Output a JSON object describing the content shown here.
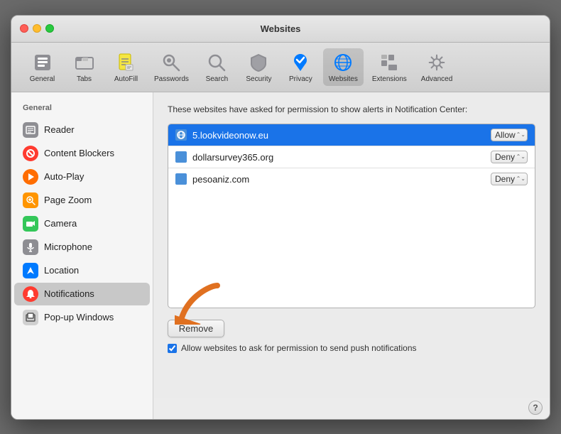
{
  "window": {
    "title": "Websites"
  },
  "toolbar": {
    "items": [
      {
        "id": "general",
        "label": "General",
        "icon": "⚙"
      },
      {
        "id": "tabs",
        "label": "Tabs",
        "icon": "▭"
      },
      {
        "id": "autofill",
        "label": "AutoFill",
        "icon": "✏"
      },
      {
        "id": "passwords",
        "label": "Passwords",
        "icon": "🔑"
      },
      {
        "id": "search",
        "label": "Search",
        "icon": "🔍"
      },
      {
        "id": "security",
        "label": "Security",
        "icon": "🛡"
      },
      {
        "id": "privacy",
        "label": "Privacy",
        "icon": "✋"
      },
      {
        "id": "websites",
        "label": "Websites",
        "icon": "🌐"
      },
      {
        "id": "extensions",
        "label": "Extensions",
        "icon": "🧩"
      },
      {
        "id": "advanced",
        "label": "Advanced",
        "icon": "⚙"
      }
    ],
    "active": "websites"
  },
  "sidebar": {
    "header": "General",
    "items": [
      {
        "id": "reader",
        "label": "Reader",
        "icon": "≡",
        "iconBg": "#8e8e93",
        "iconColor": "white"
      },
      {
        "id": "content-blockers",
        "label": "Content Blockers",
        "icon": "●",
        "iconBg": "#ff3b30",
        "iconColor": "white"
      },
      {
        "id": "auto-play",
        "label": "Auto-Play",
        "icon": "▶",
        "iconBg": "#ff6d00",
        "iconColor": "white"
      },
      {
        "id": "page-zoom",
        "label": "Page Zoom",
        "icon": "🔍",
        "iconBg": "#ff9500",
        "iconColor": "white"
      },
      {
        "id": "camera",
        "label": "Camera",
        "icon": "◼",
        "iconBg": "#34c759",
        "iconColor": "white"
      },
      {
        "id": "microphone",
        "label": "Microphone",
        "icon": "🎤",
        "iconBg": "#8e8e93",
        "iconColor": "white"
      },
      {
        "id": "location",
        "label": "Location",
        "icon": "✈",
        "iconBg": "#007aff",
        "iconColor": "white"
      },
      {
        "id": "notifications",
        "label": "Notifications",
        "icon": "●",
        "iconBg": "#ff3b30",
        "iconColor": "white",
        "active": true
      },
      {
        "id": "popup-windows",
        "label": "Pop-up Windows",
        "icon": "▭",
        "iconBg": "#8e8e8e",
        "iconColor": "white"
      }
    ]
  },
  "panel": {
    "description": "These websites have asked for permission to show alerts in Notification Center:",
    "websites": [
      {
        "id": "site1",
        "name": "5.lookvideonow.eu",
        "permission": "Allow",
        "selected": true
      },
      {
        "id": "site2",
        "name": "dollarsurvey365.org",
        "permission": "Deny",
        "selected": false
      },
      {
        "id": "site3",
        "name": "pesoaniz.com",
        "permission": "Deny",
        "selected": false
      }
    ],
    "permission_options": [
      "Allow",
      "Deny"
    ],
    "remove_button_label": "Remove",
    "checkbox_label": "Allow websites to ask for permission to send push notifications",
    "checkbox_checked": true
  },
  "help": {
    "label": "?"
  }
}
